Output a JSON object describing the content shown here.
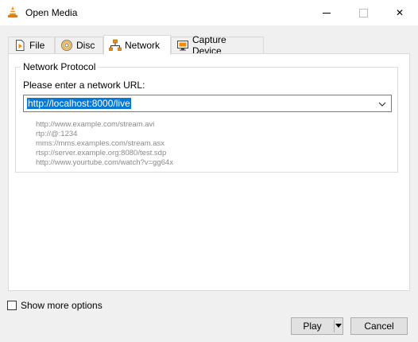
{
  "window": {
    "title": "Open Media",
    "app_icon": "vlc-cone-icon",
    "controls": [
      "minimize",
      "maximize",
      "close"
    ],
    "close_glyph": "✕"
  },
  "tabs": [
    {
      "label": "File",
      "icon": "file-icon",
      "active": false
    },
    {
      "label": "Disc",
      "icon": "disc-icon",
      "active": false
    },
    {
      "label": "Network",
      "icon": "network-icon",
      "active": true
    },
    {
      "label": "Capture Device",
      "icon": "capture-device-icon",
      "active": false
    }
  ],
  "network": {
    "group_title": "Network Protocol",
    "prompt": "Please enter a network URL:",
    "url_value": "http://localhost:8000/live",
    "examples": [
      "http://www.example.com/stream.avi",
      "rtp://@:1234",
      "mms://mms.examples.com/stream.asx",
      "rtsp://server.example.org:8080/test.sdp",
      "http://www.yourtube.com/watch?v=gg64x"
    ]
  },
  "options": {
    "show_more_label": "Show more options",
    "show_more_checked": false
  },
  "buttons": {
    "play_label": "Play",
    "cancel_label": "Cancel"
  },
  "colors": {
    "accent_selection": "#0078d7",
    "vlc_orange": "#f48a00"
  }
}
